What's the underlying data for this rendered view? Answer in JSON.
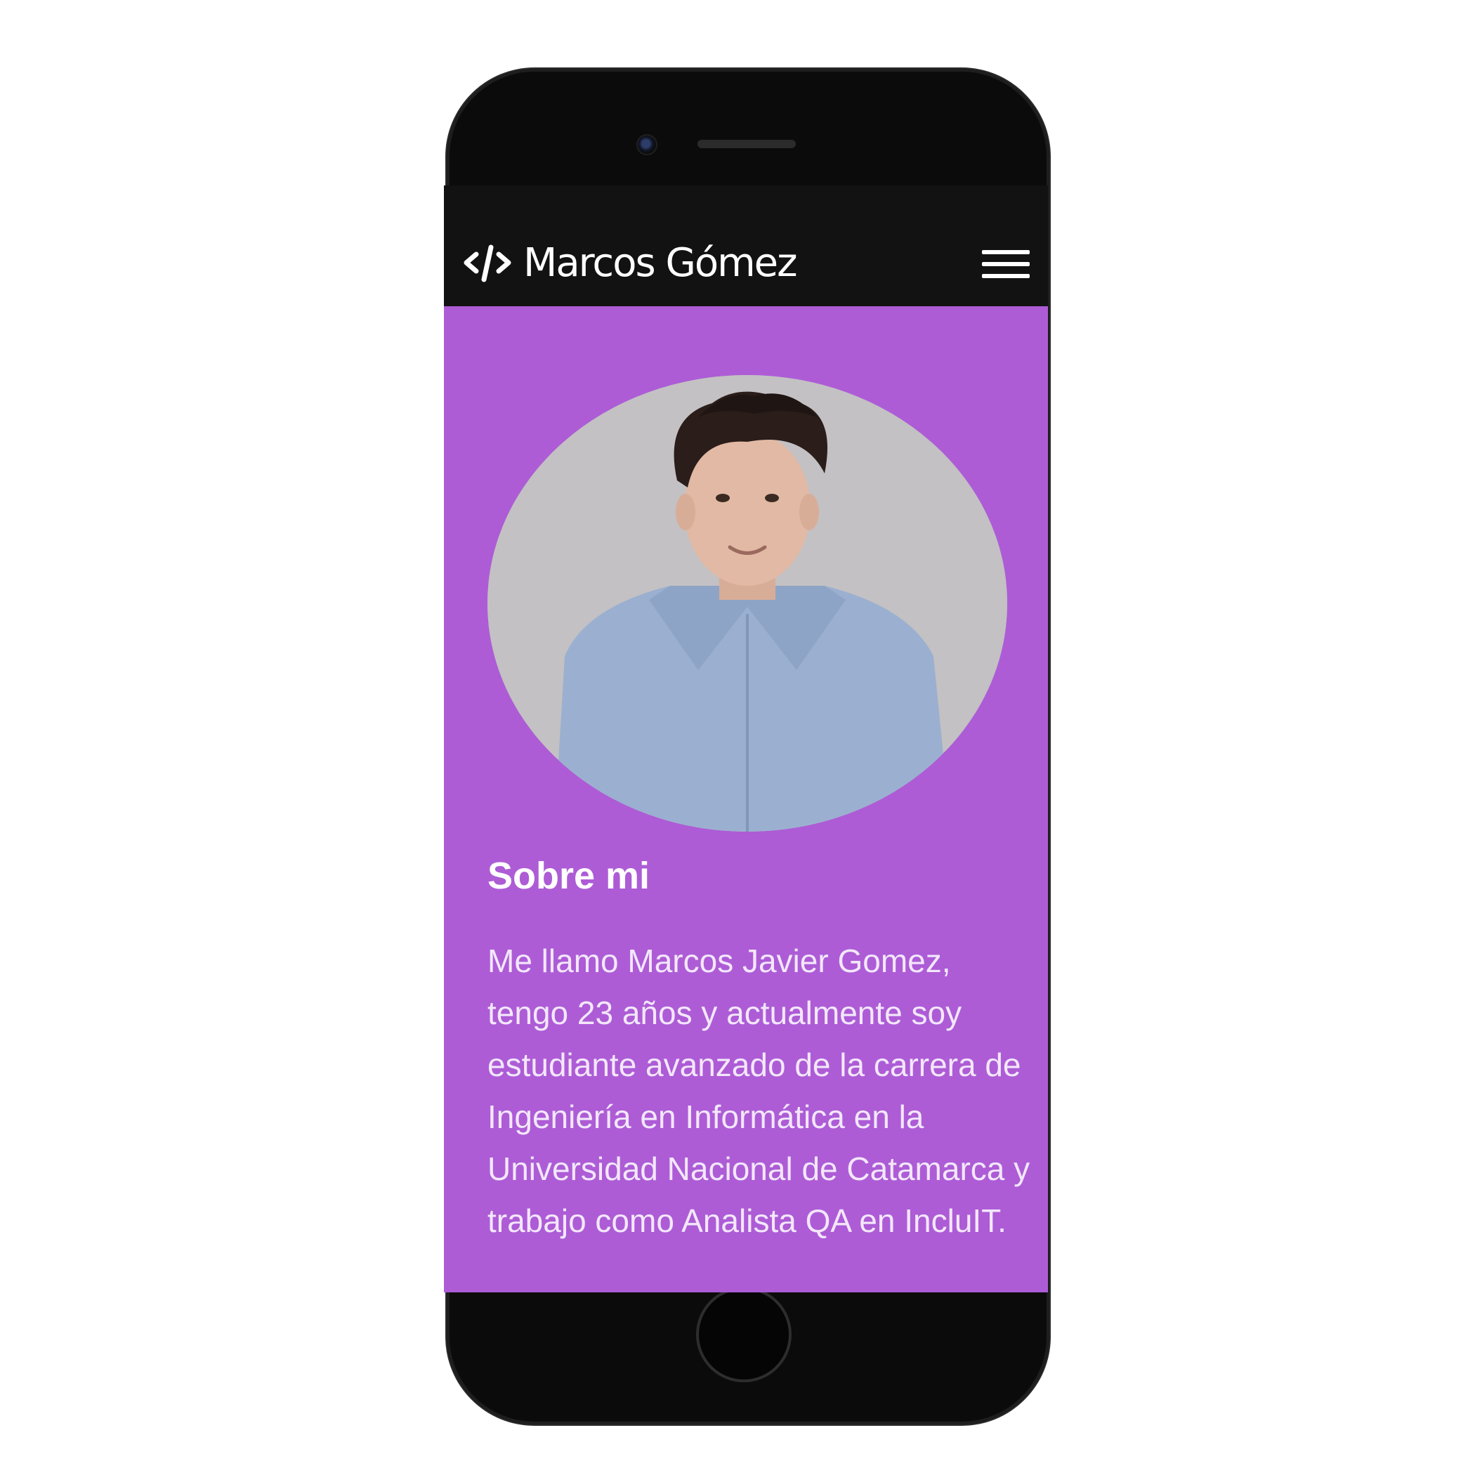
{
  "header": {
    "brand_icon": "code-icon",
    "brand_name": "Marcos Gómez",
    "menu_icon": "hamburger-menu-icon"
  },
  "profile": {
    "photo": "profile-photo"
  },
  "about": {
    "title": "Sobre mi",
    "text": "Me llamo Marcos Javier Gomez, tengo 23 años y actualmente soy estudiante avanzado de la carrera de Ingeniería en Informática en la Universidad Nacional de Catamarca y trabajo como Analista QA en IncluIT."
  },
  "colors": {
    "navbar": "#121212",
    "accent_background": "#ad5cd6",
    "text": "#ffffff"
  }
}
